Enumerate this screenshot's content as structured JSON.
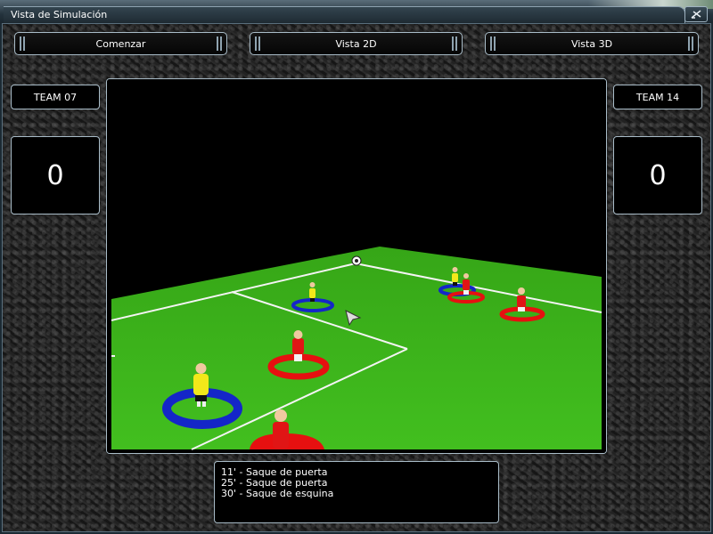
{
  "window": {
    "title": "Vista de Simulación"
  },
  "toolbar": {
    "start_label": "Comenzar",
    "view2d_label": "Vista 2D",
    "view3d_label": "Vista 3D"
  },
  "left_team": {
    "name": "TEAM 07",
    "score": "0"
  },
  "right_team": {
    "name": "TEAM 14",
    "score": "0"
  },
  "events": [
    "11' - Saque de puerta",
    "25' - Saque de puerta",
    "30' - Saque de esquina"
  ],
  "colors": {
    "pitch": "#3eb51c",
    "team_yellow": "#f2e81a",
    "team_red": "#e01515",
    "ring_blue": "#1426c8",
    "ring_red": "#e61010"
  },
  "icons": {
    "close": "close-icon",
    "ball": "soccer-ball-icon",
    "cursor": "arrow-cursor-icon"
  }
}
